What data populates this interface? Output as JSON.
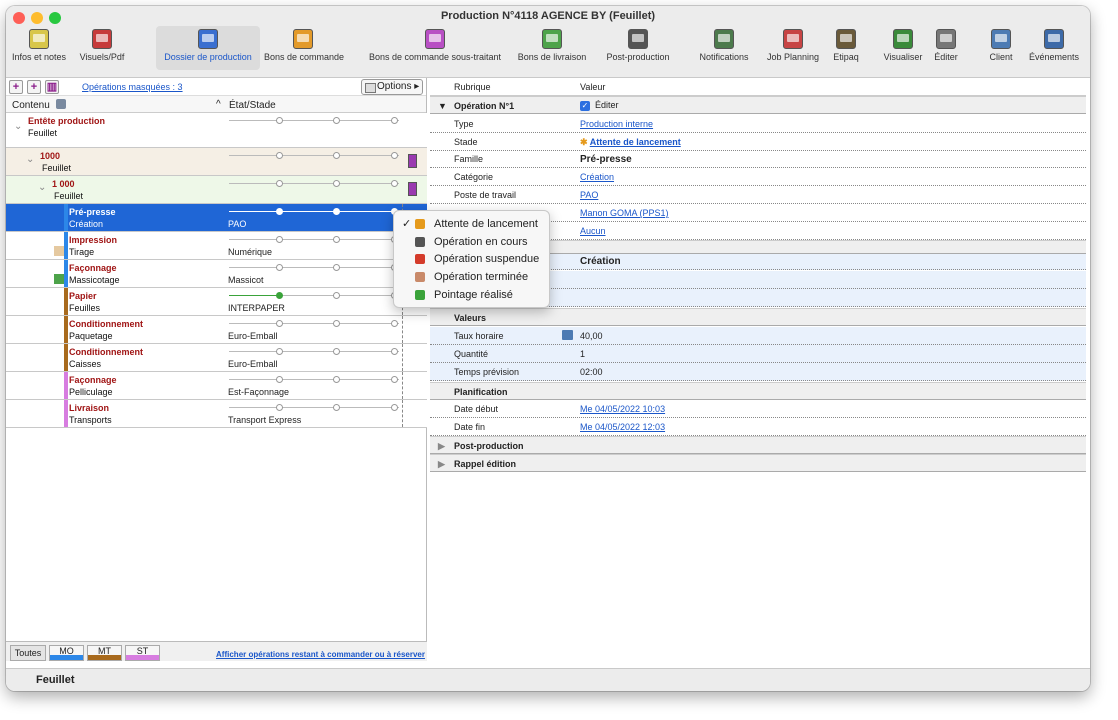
{
  "window": {
    "title": "Production N°4118 AGENCE BY (Feuillet)",
    "status": "Feuillet"
  },
  "toolbar": [
    {
      "label": "Infos et notes",
      "icon": "notes-icon",
      "color": "#d8c64a"
    },
    {
      "label": "Visuels/Pdf",
      "icon": "pdf-icon",
      "color": "#c63b3b"
    },
    {
      "label": "Dossier de production",
      "icon": "folder-icon",
      "color": "#3a6fd0"
    },
    {
      "label": "Bons de commande",
      "icon": "order-icon",
      "color": "#e39a2a"
    },
    {
      "label": "Bons de commande sous-traitant",
      "icon": "subcontract-icon",
      "color": "#b84fc4"
    },
    {
      "label": "Bons de livraison",
      "icon": "delivery-icon",
      "color": "#4da34a"
    },
    {
      "label": "Post-production",
      "icon": "puzzle-icon",
      "color": "#555555"
    },
    {
      "label": "Notifications",
      "icon": "notification-icon",
      "color": "#4c7a4c"
    },
    {
      "label": "Job Planning",
      "icon": "calendar-icon",
      "color": "#c74444"
    },
    {
      "label": "Etipaq",
      "icon": "box-icon",
      "color": "#6a5a3a"
    },
    {
      "label": "Visualiser",
      "icon": "eye-icon",
      "color": "#3a8a3a"
    },
    {
      "label": "Éditer",
      "icon": "edit-icon",
      "color": "#777777"
    },
    {
      "label": "Client",
      "icon": "client-icon",
      "color": "#4d7bb3"
    },
    {
      "label": "Événements",
      "icon": "events-icon",
      "color": "#3d6aa8"
    }
  ],
  "left": {
    "masked": "Opérations masquées : 3",
    "options": "Options",
    "col1": "Contenu",
    "col2": "État/Stade",
    "rows": [
      {
        "name": "Entête production",
        "sub": "Feuillet",
        "state": "",
        "progress": 0,
        "bar": ""
      },
      {
        "name": "1000",
        "sub": "Feuillet",
        "state": "",
        "progress": 0,
        "bar": ""
      },
      {
        "name": "1 000",
        "sub": "Feuillet",
        "state": "",
        "progress": 0,
        "bar": ""
      },
      {
        "name": "Pré-presse",
        "sub": "Création",
        "state": "PAO",
        "progress": 1,
        "bar": "#2c87e8"
      },
      {
        "name": "Impression",
        "sub": "Tirage",
        "state": "Numérique",
        "progress": 0,
        "bar": "#2c87e8"
      },
      {
        "name": "Façonnage",
        "sub": "Massicotage",
        "state": "Massicot",
        "progress": 0,
        "bar": "#2c87e8"
      },
      {
        "name": "Papier",
        "sub": "Feuilles",
        "state": "INTERPAPER",
        "progress": 0.3,
        "bar": "#a86a1d"
      },
      {
        "name": "Conditionnement",
        "sub": "Paquetage",
        "state": "Euro-Emball",
        "progress": 0,
        "bar": "#a86a1d"
      },
      {
        "name": "Conditionnement",
        "sub": "Caisses",
        "state": "Euro-Emball",
        "progress": 0,
        "bar": "#a86a1d"
      },
      {
        "name": "Façonnage",
        "sub": "Pelliculage",
        "state": "Est-Façonnage",
        "progress": 0,
        "bar": "#d77de0"
      },
      {
        "name": "Livraison",
        "sub": "Transports",
        "state": "Transport Express",
        "progress": 0,
        "bar": "#d77de0"
      }
    ],
    "filters": {
      "all": "Toutes",
      "mo": "MO",
      "mt": "MT",
      "st": "ST",
      "link": "Afficher opérations restant à commander ou à réserver"
    }
  },
  "right": {
    "h1": "Rubrique",
    "h2": "Valeur",
    "op": "Opération N°1",
    "edit": "Éditer",
    "type_k": "Type",
    "type_v": "Production interne",
    "stade_k": "Stade",
    "stade_v": "Attente de lancement",
    "fam_k": "Famille",
    "fam_v": "Pré-presse",
    "cat_k": "Catégorie",
    "cat_v": "Création",
    "poste_k": "Poste de travail",
    "poste_v": "PAO",
    "op_v": "Manon GOMA (PPS1)",
    "aucun": "Aucun",
    "creation": "Création",
    "valeurs": "Valeurs",
    "taux_k": "Taux horaire",
    "taux_v": "40,00",
    "qte_k": "Quantité",
    "qte_v": "1",
    "temps_k": "Temps prévision",
    "temps_v": "02:00",
    "planif": "Planification",
    "deb_k": "Date début",
    "deb_v": "Me 04/05/2022 10:03",
    "fin_k": "Date fin",
    "fin_v": "Me 04/05/2022 12:03",
    "post": "Post-production",
    "rappel": "Rappel édition"
  },
  "menu": [
    {
      "label": "Attente de lancement",
      "checked": true,
      "color": "#e59a1c"
    },
    {
      "label": "Opération en cours",
      "checked": false,
      "color": "#555555"
    },
    {
      "label": "Opération suspendue",
      "checked": false,
      "color": "#d43b2b"
    },
    {
      "label": "Opération terminée",
      "checked": false,
      "color": "#c98a6a"
    },
    {
      "label": "Pointage réalisé",
      "checked": false,
      "color": "#3aa33a"
    }
  ]
}
